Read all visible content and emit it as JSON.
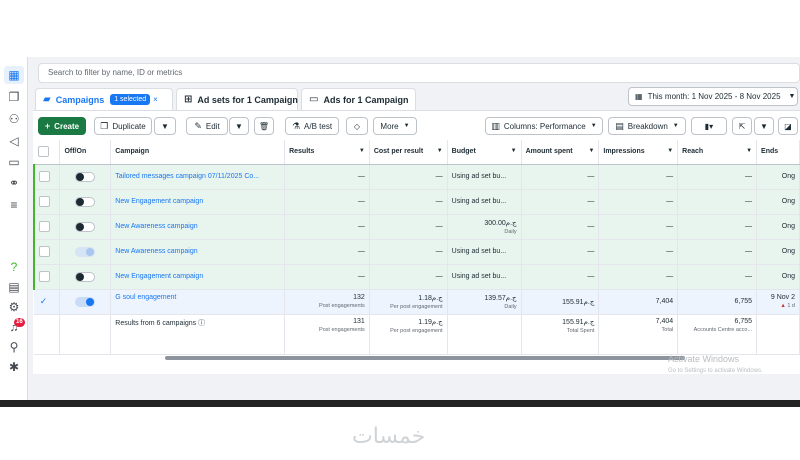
{
  "search": {
    "placeholder": "Search to filter by name, ID or metrics"
  },
  "tabs": [
    {
      "label": "Campaigns",
      "chip": "1 selected"
    },
    {
      "label": "Ad sets for 1 Campaign"
    },
    {
      "label": "Ads for 1 Campaign"
    }
  ],
  "date_range": "This month: 1 Nov 2025 - 8 Nov 2025",
  "toolbar": {
    "create": "Create",
    "duplicate": "Duplicate",
    "edit": "Edit",
    "ab_test": "A/B test",
    "more": "More",
    "columns": "Columns: Performance",
    "breakdown": "Breakdown"
  },
  "left_badge": "16",
  "columns": {
    "offon": "Off/On",
    "campaign": "Campaign",
    "results": "Results",
    "cost": "Cost per result",
    "budget": "Budget",
    "spent": "Amount spent",
    "impressions": "Impressions",
    "reach": "Reach",
    "ends": "Ends"
  },
  "rows": [
    {
      "name": "Tailored messages campaign 07/11/2025 Co...",
      "results": "—",
      "cost": "—",
      "budget": "Using ad set bu...",
      "spent": "—",
      "impressions": "—",
      "reach": "—",
      "ends": "Ong"
    },
    {
      "name": "New Engagement campaign",
      "results": "—",
      "cost": "—",
      "budget": "Using ad set bu...",
      "spent": "—",
      "impressions": "—",
      "reach": "—",
      "ends": "Ong"
    },
    {
      "name": "New Awareness campaign",
      "results": "—",
      "cost": "—",
      "budget": "300.00ج.م",
      "budget_sub": "Daily",
      "spent": "—",
      "impressions": "—",
      "reach": "—",
      "ends": "Ong"
    },
    {
      "name": "New Awareness campaign",
      "results": "—",
      "cost": "—",
      "budget": "Using ad set bu...",
      "spent": "—",
      "impressions": "—",
      "reach": "—",
      "ends": "Ong"
    },
    {
      "name": "New Engagement campaign",
      "results": "—",
      "cost": "—",
      "budget": "Using ad set bu...",
      "spent": "—",
      "impressions": "—",
      "reach": "—",
      "ends": "Ong"
    },
    {
      "name": "G soul engagement",
      "results": "132",
      "results_sub": "Post engagements",
      "cost": "1.18ج.م",
      "cost_sub": "Per post engagement",
      "budget": "139.57ج.م",
      "budget_sub": "Daily",
      "spent": "155.91ج.م",
      "impressions": "7,404",
      "reach": "6,755",
      "ends": "9 Nov 2",
      "ends_sub": "1 d"
    }
  ],
  "totals": {
    "label": "Results from 6 campaigns",
    "results": "131",
    "results_sub": "Post engagements",
    "cost": "1.19ج.م",
    "cost_sub": "Per post engagement",
    "spent": "155.91ج.م",
    "spent_sub": "Total Spent",
    "impressions": "7,404",
    "impressions_sub": "Total",
    "reach": "6,755",
    "reach_sub": "Accounts Centre acco..."
  },
  "watermark": {
    "line1": "Activate Windows",
    "line2": "Go to Settings to activate Windows."
  },
  "brand": "خمسات"
}
